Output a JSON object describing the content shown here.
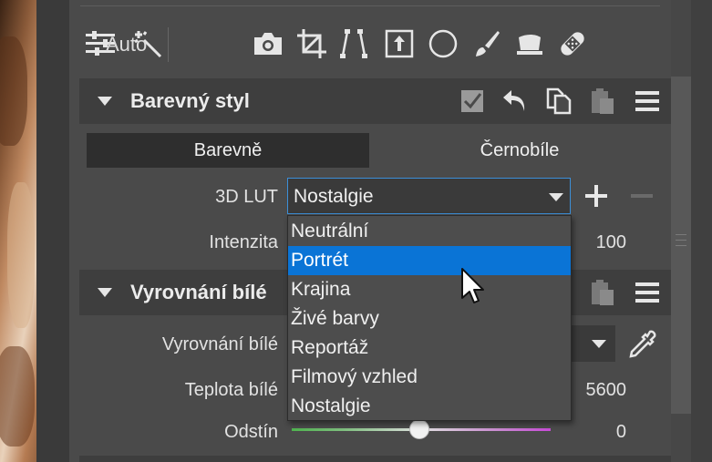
{
  "toolbar": {
    "auto_label": "Auto",
    "tools": [
      "sliders-icon",
      "magic-wand-icon",
      "camera-icon",
      "crop-icon",
      "perspective-icon",
      "upload-frame-icon",
      "circle-icon",
      "brush-icon",
      "eraser-icon",
      "bandage-icon"
    ]
  },
  "section_color_style": {
    "title": "Barevný styl",
    "icons": [
      "checkbox-icon",
      "undo-icon",
      "copy-icon",
      "paste-icon",
      "menu-icon"
    ],
    "tab_color": "Barevně",
    "tab_bw": "Černobíle",
    "lut_label": "3D LUT",
    "lut_value": "Nostalgie",
    "intensity_label": "Intenzita",
    "intensity_value": "100"
  },
  "section_white_balance": {
    "title": "Vyrovnání bílé",
    "wb_label": "Vyrovnání bílé",
    "temp_label": "Teplota bílé",
    "temp_value": "5600",
    "tint_label": "Odstín",
    "tint_value": "0"
  },
  "dropdown": {
    "options": [
      "Neutrální",
      "Portrét",
      "Krajina",
      "Živé barvy",
      "Reportáž",
      "Filmový vzhled",
      "Nostalgie"
    ],
    "highlighted": "Portrét"
  },
  "colors": {
    "accent": "#0a74d6",
    "panel_bg": "#4a4a4a",
    "header_bg": "#3e3e3e"
  }
}
